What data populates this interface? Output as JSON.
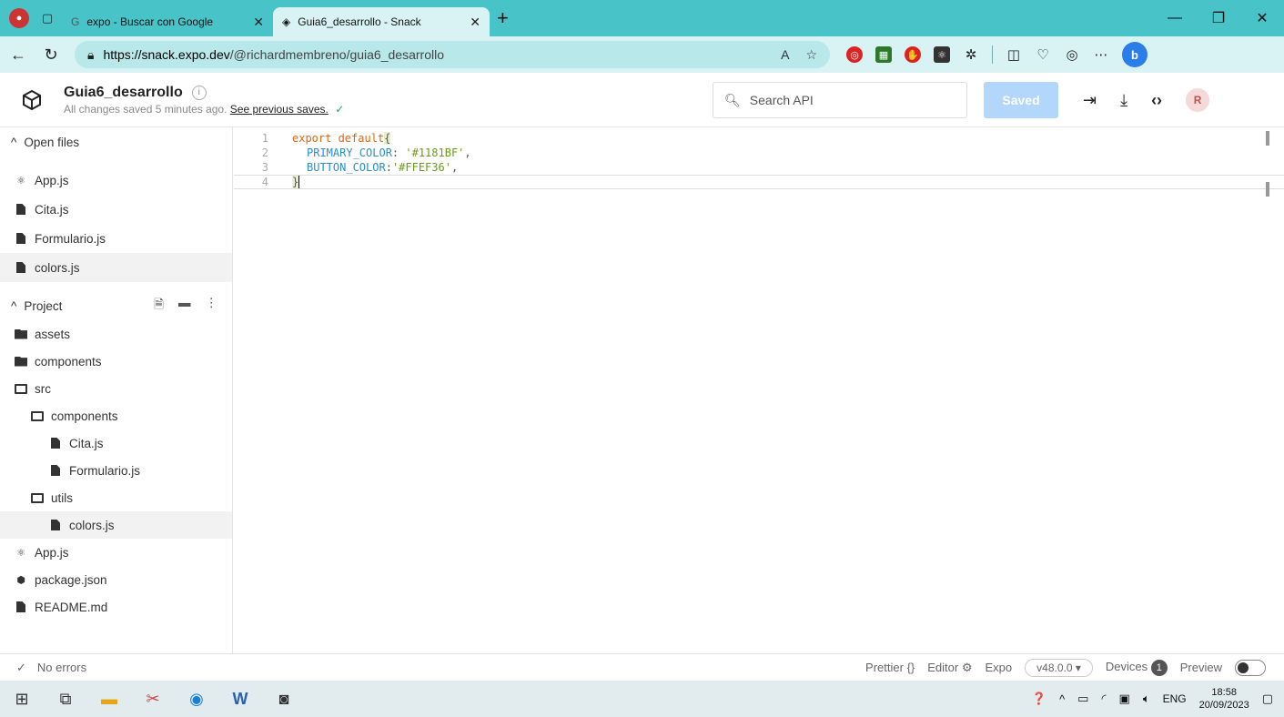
{
  "browser": {
    "tabs": [
      {
        "title": "expo - Buscar con Google",
        "active": false
      },
      {
        "title": "Guia6_desarrollo - Snack",
        "active": true
      }
    ],
    "url_host": "https://snack.expo.dev",
    "url_path": "/@richardmembreno/guia6_desarrollo"
  },
  "header": {
    "project_name": "Guia6_desarrollo",
    "save_status": "All changes saved 5 minutes ago.",
    "previous_saves": "See previous saves.",
    "search_placeholder": "Search API",
    "saved_label": "Saved",
    "avatar_initial": "R"
  },
  "sidebar": {
    "open_files_label": "Open files",
    "open_files": [
      "App.js",
      "Cita.js",
      "Formulario.js",
      "colors.js"
    ],
    "project_label": "Project",
    "tree": [
      {
        "label": "assets",
        "kind": "folder",
        "depth": 0
      },
      {
        "label": "components",
        "kind": "folder",
        "depth": 0
      },
      {
        "label": "src",
        "kind": "folder-open",
        "depth": 0
      },
      {
        "label": "components",
        "kind": "folder-open",
        "depth": 1
      },
      {
        "label": "Cita.js",
        "kind": "file",
        "depth": 2
      },
      {
        "label": "Formulario.js",
        "kind": "file",
        "depth": 2
      },
      {
        "label": "utils",
        "kind": "folder-open",
        "depth": 1
      },
      {
        "label": "colors.js",
        "kind": "file",
        "depth": 2,
        "selected": true
      },
      {
        "label": "App.js",
        "kind": "react",
        "depth": 0
      },
      {
        "label": "package.json",
        "kind": "pkg",
        "depth": 0
      },
      {
        "label": "README.md",
        "kind": "file",
        "depth": 0
      }
    ]
  },
  "editor": {
    "lines": [
      {
        "n": "1",
        "keyword": "export default",
        "rest": "{"
      },
      {
        "n": "2",
        "prop": "PRIMARY_COLOR",
        "sep": ": ",
        "str": "'#1181BF'",
        "end": ","
      },
      {
        "n": "3",
        "prop": "BUTTON_COLOR",
        "sep": ":",
        "str": "'#FFEF36'",
        "end": ","
      },
      {
        "n": "4",
        "punc": "}"
      }
    ]
  },
  "footer": {
    "errors": "No errors",
    "prettier": "Prettier",
    "prettier_icon": "{}",
    "editor": "Editor",
    "expo": "Expo",
    "version": "v48.0.0 ▾",
    "devices": "Devices",
    "devices_count": "1",
    "preview": "Preview"
  },
  "taskbar": {
    "lang": "ENG",
    "time": "18:58",
    "date": "20/09/2023"
  },
  "colors": {
    "browser_chrome": "#48c4c8",
    "saved_button": "#b3d6fb",
    "keyword": "#d46a1a",
    "property": "#2a8fc5",
    "string": "#6a9a1a"
  }
}
